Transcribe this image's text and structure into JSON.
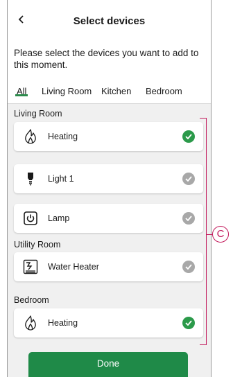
{
  "header": {
    "title": "Select devices",
    "back_icon": "chevron-left-icon"
  },
  "instructions": "Please select the devices you want to add to this moment.",
  "tabs": [
    {
      "label": "All",
      "active": true
    },
    {
      "label": "Living Room",
      "active": false
    },
    {
      "label": "Kitchen",
      "active": false
    },
    {
      "label": "Bedroom",
      "active": false
    }
  ],
  "sections": [
    {
      "title": "Living Room",
      "devices": [
        {
          "label": "Heating",
          "icon": "flame-icon",
          "selected": true
        },
        {
          "label": "Light 1",
          "icon": "bulb-icon",
          "selected": false
        },
        {
          "label": "Lamp",
          "icon": "power-socket-icon",
          "selected": false
        }
      ]
    },
    {
      "title": "Utility Room",
      "devices": [
        {
          "label": "Water Heater",
          "icon": "water-heater-icon",
          "selected": false
        }
      ]
    },
    {
      "title": "Bedroom",
      "devices": [
        {
          "label": "Heating",
          "icon": "flame-icon",
          "selected": true
        }
      ]
    }
  ],
  "done_label": "Done",
  "callout_label": "C",
  "colors": {
    "accent": "#1f8a48",
    "check_on": "#2b9a4a",
    "check_off": "#a8a8a8",
    "callout": "#c2185b"
  }
}
